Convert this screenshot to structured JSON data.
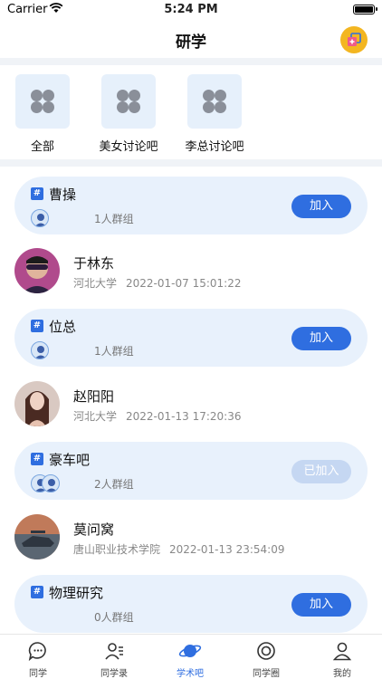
{
  "status": {
    "carrier": "Carrier",
    "time": "5:24 PM"
  },
  "nav": {
    "title": "研学"
  },
  "categories": [
    {
      "label": "全部"
    },
    {
      "label": "美女讨论吧"
    },
    {
      "label": "李总讨论吧"
    }
  ],
  "feed": [
    {
      "group_name": "曹操",
      "member_count": "1人群组",
      "action": "加入"
    },
    {
      "name": "于林东",
      "school": "河北大学",
      "time": "2022-01-07 15:01:22"
    },
    {
      "group_name": "位总",
      "member_count": "1人群组",
      "action": "加入"
    },
    {
      "name": "赵阳阳",
      "school": "河北大学",
      "time": "2022-01-13 17:20:36"
    },
    {
      "group_name": "豪车吧",
      "member_count": "2人群组",
      "action": "已加入"
    },
    {
      "name": "莫问窝",
      "school": "唐山职业技术学院",
      "time": "2022-01-13 23:54:09"
    },
    {
      "group_name": "物理研究",
      "member_count": "0人群组",
      "action": "加入"
    }
  ],
  "group_marker": "#",
  "tabs": [
    {
      "label": "同学",
      "icon": "chat-bubble-icon"
    },
    {
      "label": "同学录",
      "icon": "contacts-icon"
    },
    {
      "label": "学术吧",
      "icon": "planet-icon",
      "active": true
    },
    {
      "label": "同学圈",
      "icon": "moments-icon"
    },
    {
      "label": "我的",
      "icon": "profile-icon"
    }
  ],
  "colors": {
    "accent": "#2f6ee0",
    "card_bg": "#e8f1fc",
    "joined_button": "#c5d7f2",
    "nav_action": "#f3b621"
  }
}
